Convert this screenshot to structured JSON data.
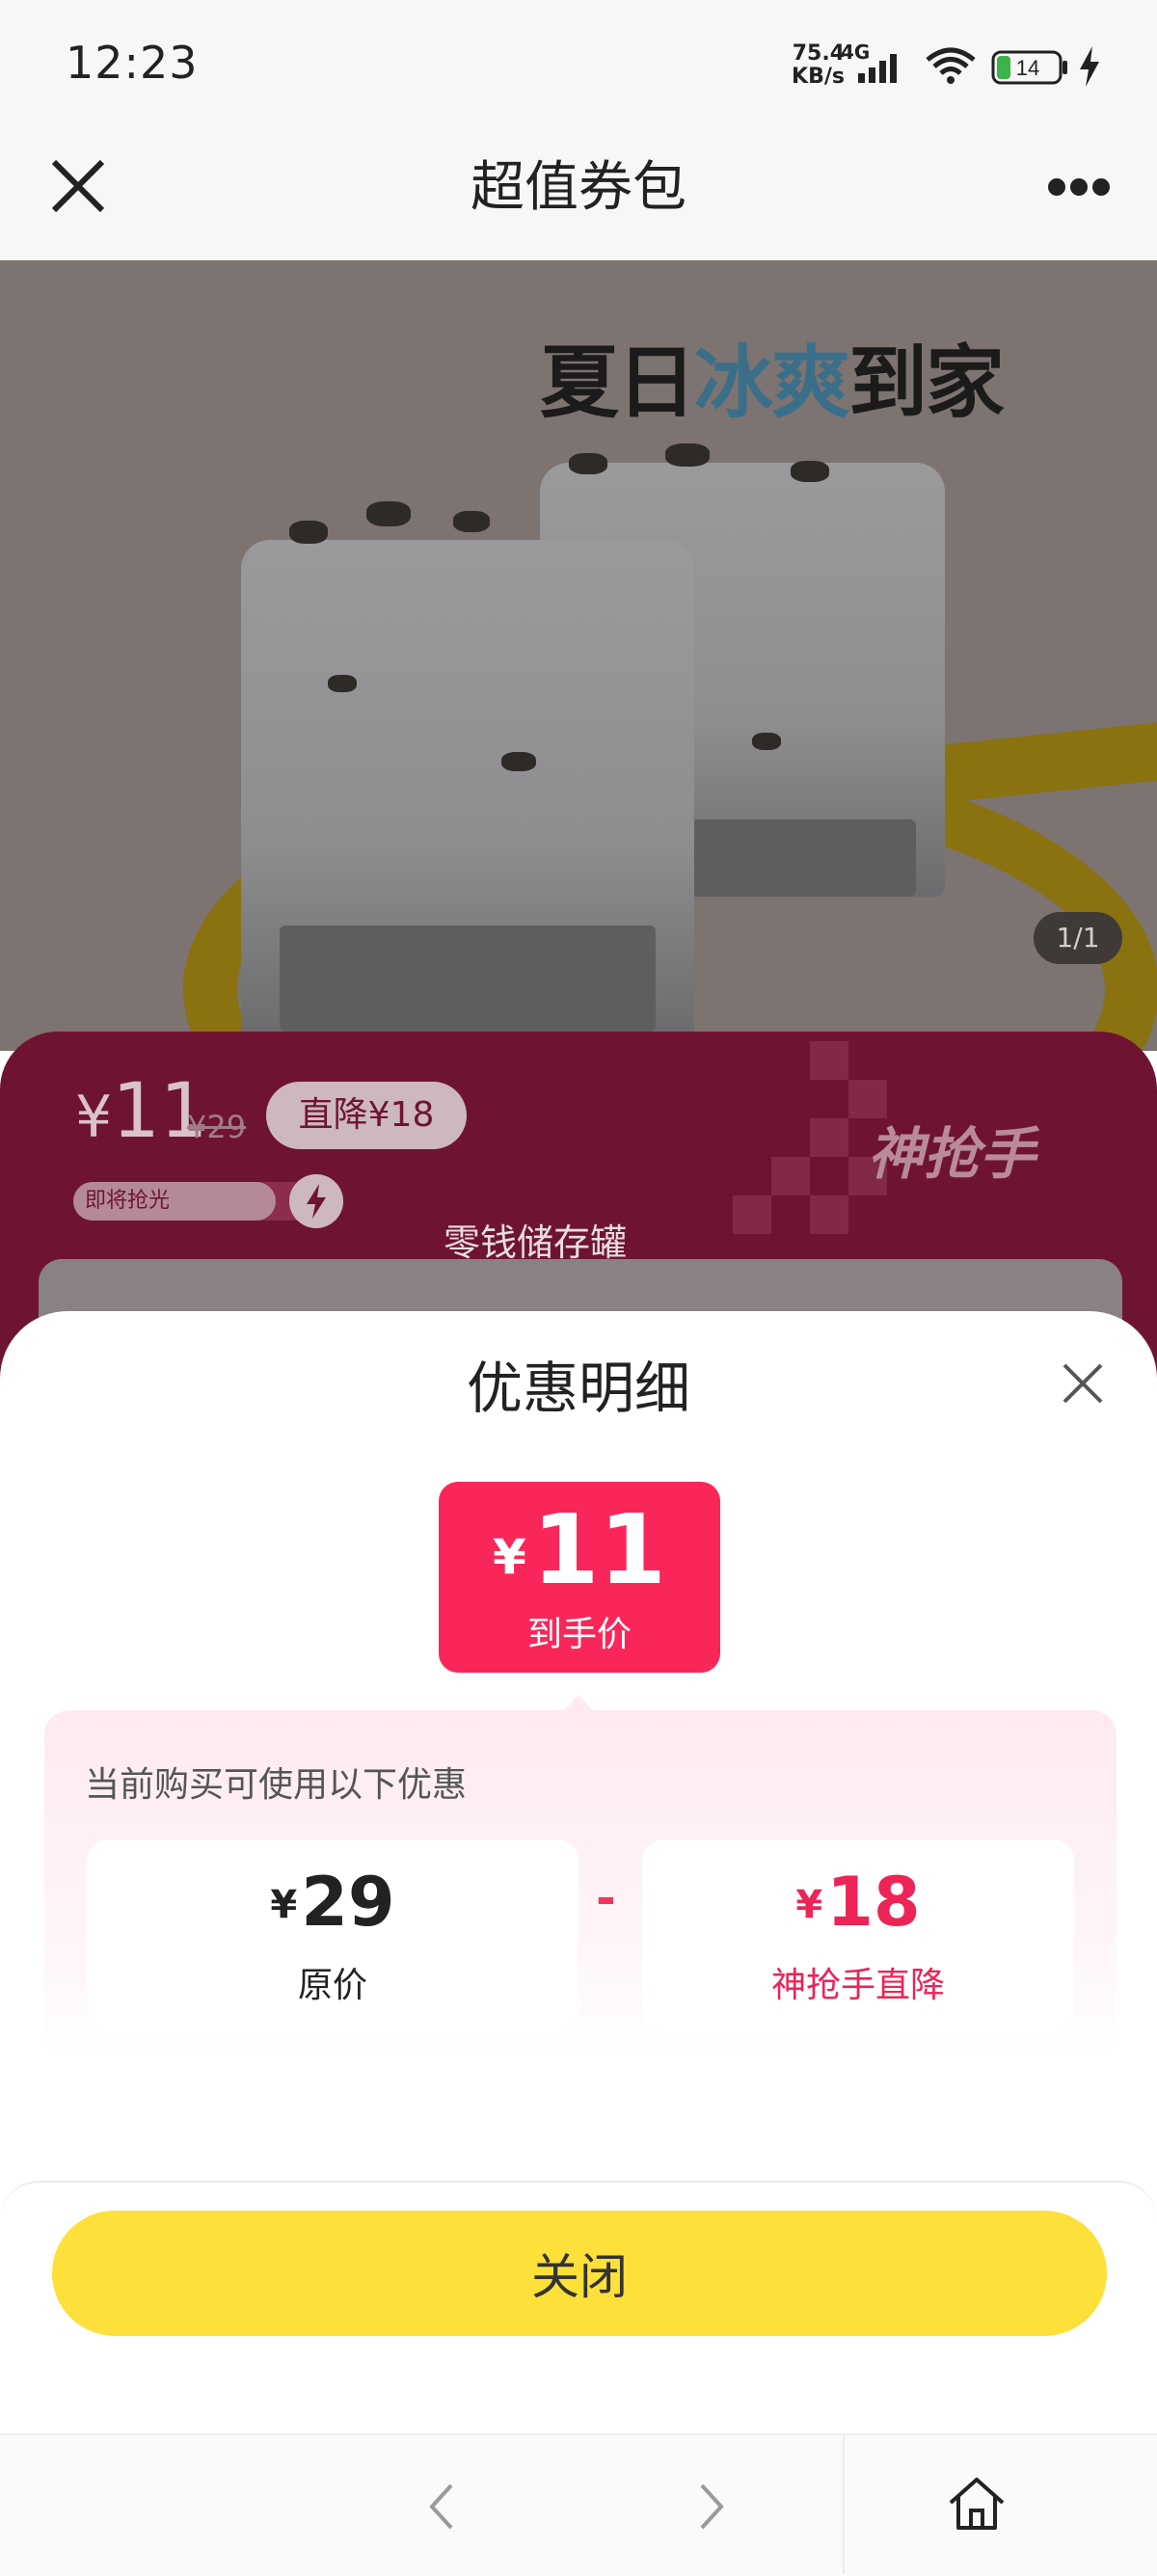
{
  "status_bar": {
    "time": "12:23",
    "net_speed_value": "75.4",
    "net_speed_unit": "KB/s",
    "network_type": "4G",
    "battery_level": "14",
    "icons": [
      "signal-icon",
      "wifi-icon",
      "battery-icon",
      "charging-icon"
    ]
  },
  "header": {
    "title": "超值券包",
    "close_icon": "close-icon",
    "more_icon": "more-icon"
  },
  "hero": {
    "campaign_logo_text_1": "夏日",
    "campaign_logo_text_2": "冰爽",
    "campaign_logo_text_3": "到家",
    "page_indicator": "1/1"
  },
  "promo": {
    "price_currency": "¥",
    "price": "11",
    "original_price": "¥29",
    "discount_badge": "直降¥18",
    "stock_label": "即将抢光",
    "brand": "神抢手",
    "description": "零钱储存罐"
  },
  "sheet": {
    "title": "优惠明细",
    "final_price_currency": "¥",
    "final_price": "11",
    "final_price_label": "到手价",
    "heading": "当前购买可使用以下优惠",
    "original": {
      "currency": "¥",
      "value": "29",
      "label": "原价"
    },
    "operator": "-",
    "discount": {
      "currency": "¥",
      "value": "18",
      "label": "神抢手直降"
    },
    "close_button": "关闭"
  },
  "colors": {
    "accent_pink": "#f9265a",
    "discount_red": "#ec2457",
    "button_yellow": "#fde03a",
    "promo_band": "#6e1432"
  }
}
